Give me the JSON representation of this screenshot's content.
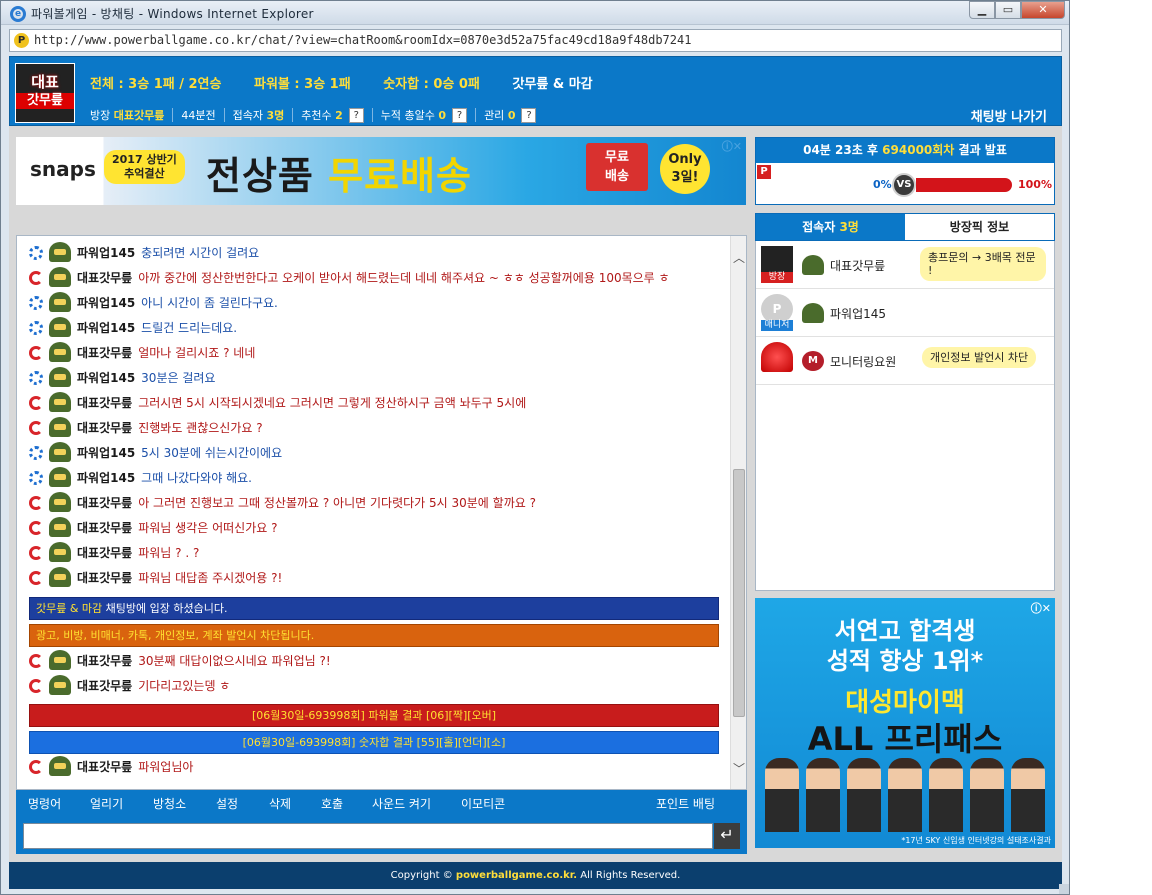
{
  "window": {
    "title": "파워볼게임 - 방채팅 - Windows Internet Explorer"
  },
  "address": {
    "url": "http://www.powerballgame.co.kr/chat/?view=chatRoom&roomIdx=0870e3d52a75fac49cd18a9f48db7241"
  },
  "header": {
    "logo_top": "대표",
    "logo_bottom": "갓무릎",
    "total": "전체 : 3승 1패 / 2연승",
    "powerball": "파워볼 : 3승 1패",
    "sum": "숫자합 : 0승 0패",
    "room_name": "갓무릎 & 마감",
    "host_label": "방장",
    "host": "대표갓무릎",
    "analysis": "44분전",
    "visitors_label": "접속자",
    "visitors": "3명",
    "recommend_label": "추천수",
    "recommend": "2",
    "cumulative_label": "누적 총알수",
    "cumulative": "0",
    "manage_label": "관리",
    "manage": "0",
    "q": "?",
    "exit": "채팅방 나가기"
  },
  "ad1": {
    "brand": "snaps",
    "tag": "2017 상반기\n추억결산",
    "headline_a": "전상품",
    "headline_b": "무료배송",
    "truck": "무료\n배송",
    "only": "Only\n3일!"
  },
  "result": {
    "title_prefix": "04분 23초 후",
    "round": "694000회차",
    "title_suffix": "결과 발표",
    "left_pct": "0%",
    "vs": "VS",
    "right_pct": "100%",
    "fill": 1.0
  },
  "messages": [
    {
      "type": "b",
      "name": "파워업145",
      "text": "충되려면 시간이 걸려요"
    },
    {
      "type": "r",
      "name": "대표갓무릎",
      "text": "아까 중간에 정산한번한다고 오케이 받아서 해드렸는데 네네 해주셔요 ~ ㅎㅎ 성공할꺼에용 100목으루 ㅎ"
    },
    {
      "type": "b",
      "name": "파워업145",
      "text": "아니 시간이 좀 걸린다구요."
    },
    {
      "type": "b",
      "name": "파워업145",
      "text": "드릴건 드리는데요."
    },
    {
      "type": "r",
      "name": "대표갓무릎",
      "text": "얼마나 걸리시죠 ? 네네"
    },
    {
      "type": "b",
      "name": "파워업145",
      "text": "30분은 걸려요"
    },
    {
      "type": "r",
      "name": "대표갓무릎",
      "text": "그러시면 5시 시작되시겠네요 그러시면 그렇게 정산하시구 금액 놔두구 5시에"
    },
    {
      "type": "r",
      "name": "대표갓무릎",
      "text": "진행봐도 괜찮으신가요 ?"
    },
    {
      "type": "b",
      "name": "파워업145",
      "text": "5시 30분에 쉬는시간이에요"
    },
    {
      "type": "b",
      "name": "파워업145",
      "text": "그때 나갔다와야 해요."
    },
    {
      "type": "r",
      "name": "대표갓무릎",
      "text": "아 그러면 진행보고 그때 정산볼까요 ? 아니면 기다렷다가 5시 30분에 할까요 ?"
    },
    {
      "type": "r",
      "name": "대표갓무릎",
      "text": "파워님 생각은 어떠신가요  ?"
    },
    {
      "type": "r",
      "name": "대표갓무릎",
      "text": "파워님 ? . ?"
    },
    {
      "type": "r",
      "name": "대표갓무릎",
      "text": "파워님 대답좀 주시겠어용 ?!"
    }
  ],
  "system": {
    "enter_room": "갓무릎 & 마감",
    "enter_suffix": "채팅방에 입장 하셨습니다.",
    "warning": "광고, 비방, 비매너, 카톡, 개인정보, 계좌 발언시 차단됩니다."
  },
  "messages2": [
    {
      "type": "r",
      "name": "대표갓무릎",
      "text": "30분째 대답이없으시네요 파워업님 ?!"
    },
    {
      "type": "r",
      "name": "대표갓무릎",
      "text": "기다리고있는뎅 ㅎ"
    }
  ],
  "results_bar": {
    "pb_prefix": "[06월30일-693998회] 파워볼 결과",
    "pb_num": "[06]",
    "pb_a": "[짝]",
    "pb_b": "[오버]",
    "sum_prefix": "[06월30일-693998회] 숫자합 결과",
    "sum_num": "[55]",
    "sum_a": "[홀]",
    "sum_b": "[언더]",
    "sum_c": "[소]"
  },
  "messages3": [
    {
      "type": "r",
      "name": "대표갓무릎",
      "text": "파워업님아"
    }
  ],
  "toolbar": [
    "명령어",
    "얼리기",
    "방청소",
    "설정",
    "삭제",
    "호출",
    "사운드 켜기",
    "이모티콘",
    "포인트 배팅"
  ],
  "send": "↵",
  "tabs": {
    "users_label": "접속자",
    "users_count": "3명",
    "room_info": "방장픽 정보"
  },
  "users": [
    {
      "badge": "방장",
      "badge_color": "#d62020",
      "name": "대표갓무릎",
      "bubble": "총프문의 → 3배목 전문 !"
    },
    {
      "badge": "매니저",
      "badge_color": "#1d7fd6",
      "name": "파워업145",
      "bubble": ""
    },
    {
      "badge": "",
      "badge_color": "",
      "name": "모니터링요원",
      "bubble": "개인정보 발언시 차단"
    }
  ],
  "ad2": {
    "line1": "서연고 합격생",
    "line2": "성적 향상 1위*",
    "brand": "대성마이맥",
    "pass": "ALL 프리패스",
    "foot": "*17년 SKY 신입생 인터넷강의 설태조사결과"
  },
  "footer": {
    "prefix": "Copyright ©",
    "site": "powerballgame.co.kr.",
    "suffix": "All Rights Reserved."
  },
  "colors": {
    "accent": "#0b78c8",
    "red": "#d3141a",
    "yellow": "#ffde3a"
  }
}
